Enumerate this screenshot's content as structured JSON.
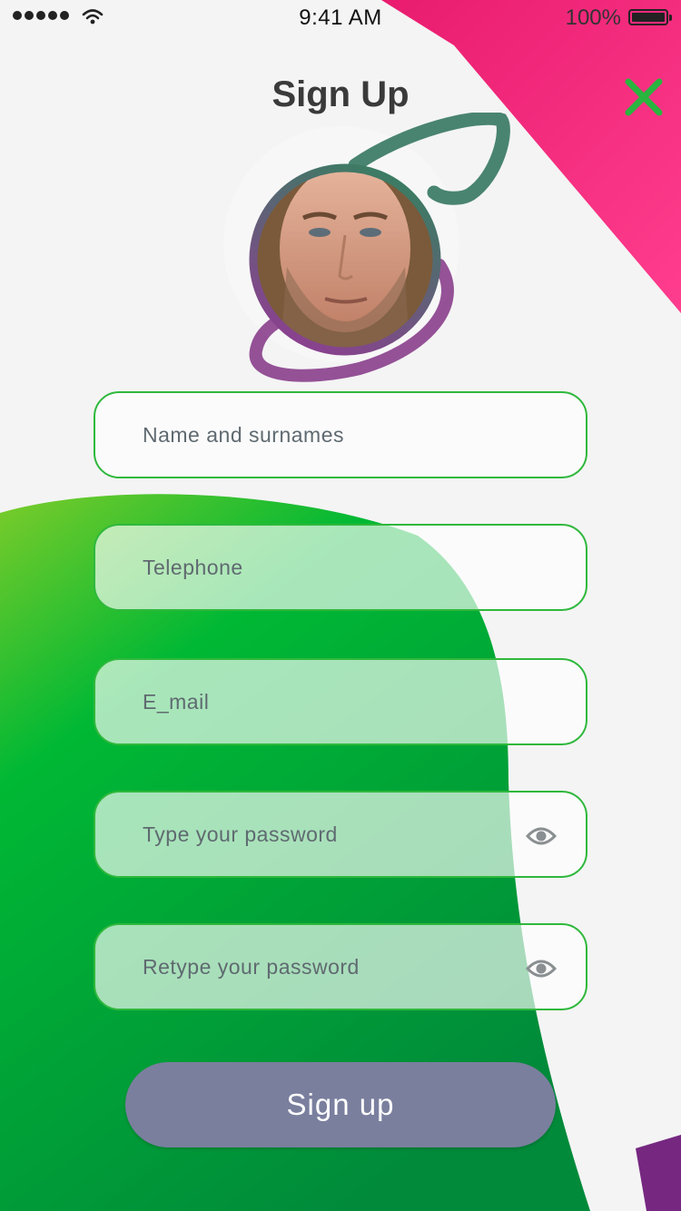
{
  "status_bar": {
    "time": "9:41 AM",
    "battery_label": "100%",
    "icons": [
      "signal-dots-icon",
      "wifi-icon",
      "battery-icon"
    ]
  },
  "header": {
    "title": "Sign Up",
    "close_icon": "close-icon"
  },
  "avatar": {
    "icon": "profile-photo"
  },
  "form": {
    "name_placeholder": "Name and surnames",
    "phone_placeholder": "Telephone",
    "email_placeholder": "E_mail",
    "password_placeholder": "Type your password",
    "retype_password_placeholder": "Retype your password",
    "eye_icon": "eye-icon",
    "submit_label": "Sign up"
  },
  "colors": {
    "accent_green": "#2fb83c",
    "pink": "#f0207a",
    "purple": "#7a2a85",
    "teal": "#3e7a6a",
    "button": "#7a7f9e",
    "title": "#3a3a3a"
  }
}
